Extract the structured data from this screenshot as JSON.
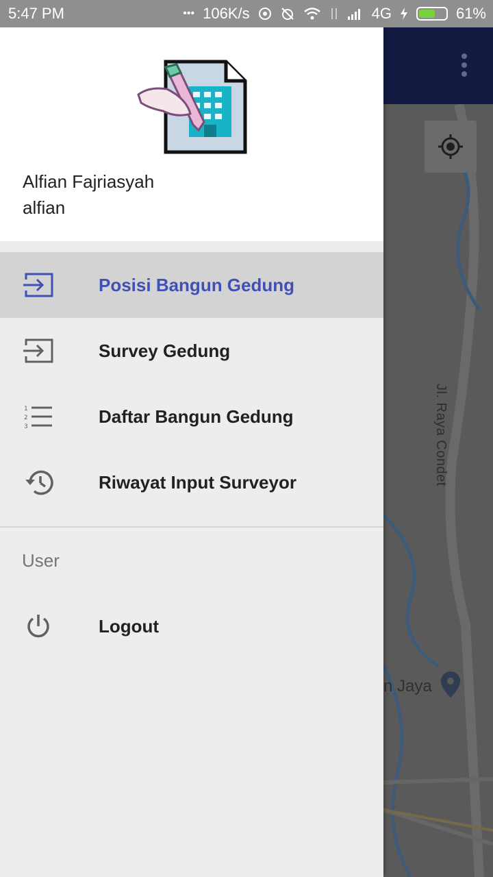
{
  "status_bar": {
    "time": "5:47 PM",
    "dots": "•••",
    "network_speed": "106K/s",
    "network_type": "4G",
    "battery_percent": "61%",
    "battery_level": 0.61
  },
  "drawer": {
    "header": {
      "logo_icon": "building-survey-document-icon",
      "user_name": "Alfian Fajriasyah",
      "user_id": "alfian"
    },
    "items": [
      {
        "label": "Posisi Bangun Gedung",
        "icon": "login-arrow-icon",
        "active": true
      },
      {
        "label": "Survey Gedung",
        "icon": "login-arrow-icon",
        "active": false
      },
      {
        "label": "Daftar Bangun Gedung",
        "icon": "numbered-list-icon",
        "active": false
      },
      {
        "label": "Riwayat Input Surveyor",
        "icon": "history-icon",
        "active": false
      }
    ],
    "section_header": "User",
    "logout_label": "Logout"
  },
  "map": {
    "road_label": "Jl. Raya Condet",
    "place_label": "n Jaya"
  },
  "colors": {
    "accent": "#3f51b5",
    "appbar": "#141b42",
    "active_item_bg": "#d3d3d3"
  }
}
